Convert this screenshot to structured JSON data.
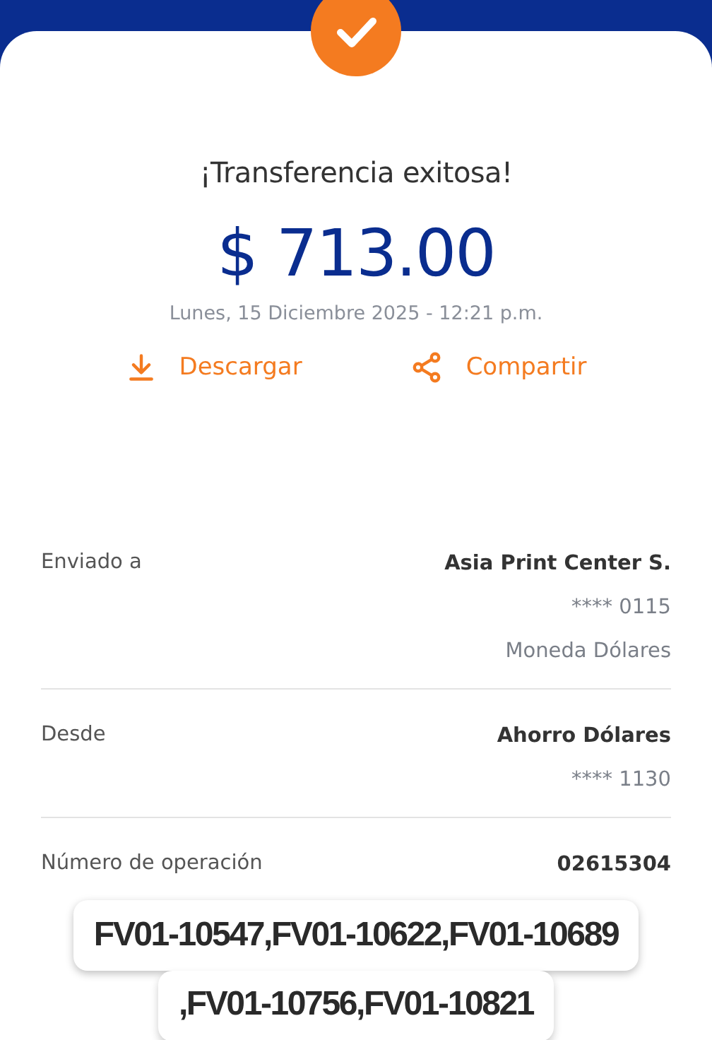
{
  "title": "¡Transferencia exitosa!",
  "amount": "$ 713.00",
  "date": "Lunes, 15 Diciembre 2025 - 12:21 p.m.",
  "actions": [
    {
      "kind": "download",
      "label": "Descargar"
    },
    {
      "kind": "share",
      "label": "Compartir"
    }
  ],
  "details": [
    {
      "label": "Enviado a",
      "values": [
        {
          "text": "Asia Print Center S.",
          "strong": true
        },
        {
          "text": "**** 0115",
          "strong": false
        },
        {
          "text": "Moneda Dólares",
          "strong": false
        }
      ]
    },
    {
      "label": "Desde",
      "values": [
        {
          "text": "Ahorro Dólares",
          "strong": true
        },
        {
          "text": "**** 1130",
          "strong": false
        }
      ]
    },
    {
      "label": "Número de operación",
      "values": [
        {
          "text": "02615304",
          "strong": true
        }
      ]
    }
  ],
  "caption_lines": [
    "FV01-10547,FV01-10622,FV01-10689",
    ",FV01-10756,FV01-10821"
  ]
}
